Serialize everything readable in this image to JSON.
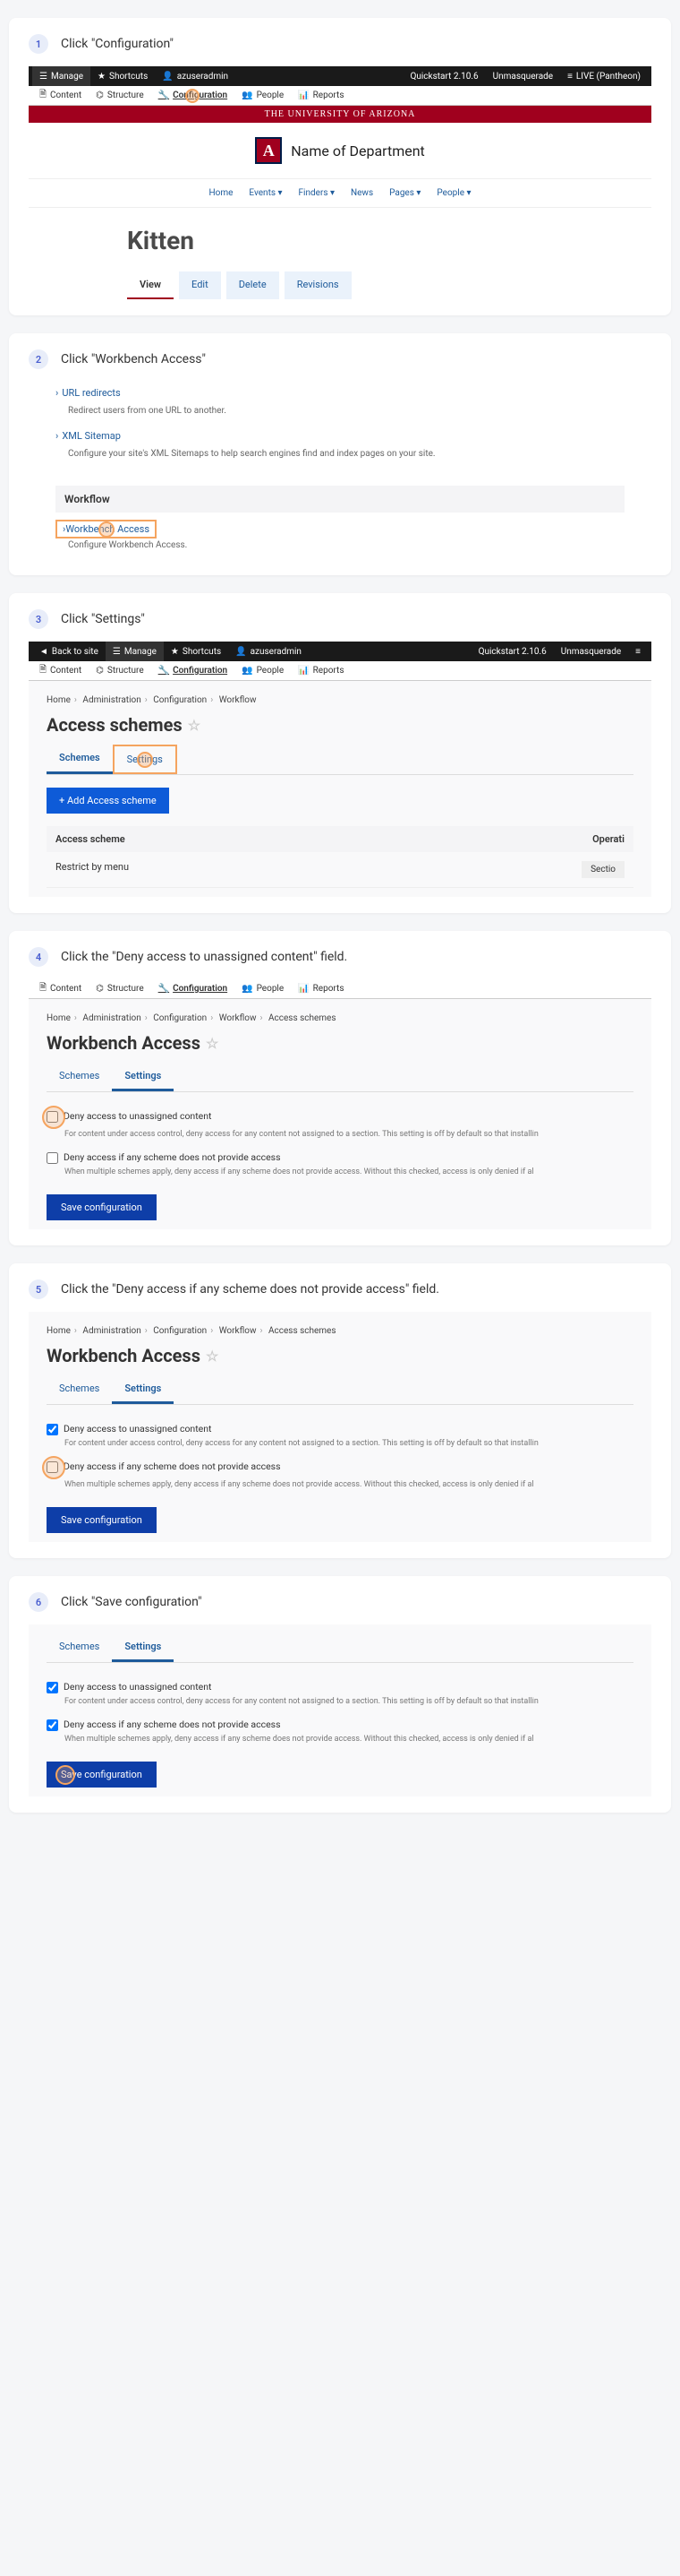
{
  "steps": {
    "s1": {
      "num": "1",
      "title": "Click \"Configuration\""
    },
    "s2": {
      "num": "2",
      "title": "Click \"Workbench Access\""
    },
    "s3": {
      "num": "3",
      "title": "Click \"Settings\""
    },
    "s4": {
      "num": "4",
      "title": "Click the \"Deny access to unassigned content\" field."
    },
    "s5": {
      "num": "5",
      "title": "Click the \"Deny access if any scheme does not provide access\" field."
    },
    "s6": {
      "num": "6",
      "title": "Click \"Save configuration\""
    }
  },
  "adminbar": {
    "manage": "Manage",
    "shortcuts": "Shortcuts",
    "user": "azuseradmin",
    "quickstart": "Quickstart 2.10.6",
    "unmasquerade": "Unmasquerade",
    "live": "LIVE (Pantheon)",
    "back": "Back to site"
  },
  "subbar": {
    "content": "Content",
    "structure": "Structure",
    "config": "Configuration",
    "people": "People",
    "reports": "Reports"
  },
  "uofa": "THE UNIVERSITY OF ARIZONA",
  "dept": "Name of Department",
  "nav": {
    "home": "Home",
    "events": "Events",
    "finders": "Finders",
    "news": "News",
    "pages": "Pages",
    "people": "People"
  },
  "page1": {
    "title": "Kitten",
    "view": "View",
    "edit": "Edit",
    "delete": "Delete",
    "revisions": "Revisions"
  },
  "step2": {
    "url_redirects": "URL redirects",
    "url_desc": "Redirect users from one URL to another.",
    "xml": "XML Sitemap",
    "xml_desc": "Configure your site's XML Sitemaps to help search engines find and index pages on your site.",
    "workflow": "Workflow",
    "wb_access": "Workbench Access",
    "wb_desc": "Configure Workbench Access."
  },
  "step3": {
    "crumbs": {
      "home": "Home",
      "admin": "Administration",
      "config": "Configuration",
      "workflow": "Workflow"
    },
    "heading": "Access schemes",
    "tab_schemes": "Schemes",
    "tab_settings": "Settings",
    "add": "+ Add Access scheme",
    "col_scheme": "Access scheme",
    "col_op": "Operati",
    "row": "Restrict by menu",
    "sect": "Sectio"
  },
  "step4": {
    "crumbs": {
      "home": "Home",
      "admin": "Administration",
      "config": "Configuration",
      "workflow": "Workflow",
      "schemes": "Access schemes"
    },
    "heading": "Workbench Access",
    "tab_schemes": "Schemes",
    "tab_settings": "Settings",
    "cb1": "Deny access to unassigned content",
    "cb1_desc": "For content under access control, deny access for any content not assigned to a section. This setting is off by default so that installin",
    "cb2": "Deny access if any scheme does not provide access",
    "cb2_desc": "When multiple schemes apply, deny access if any scheme does not provide access. Without this checked, access is only denied if al",
    "save": "Save configuration"
  }
}
